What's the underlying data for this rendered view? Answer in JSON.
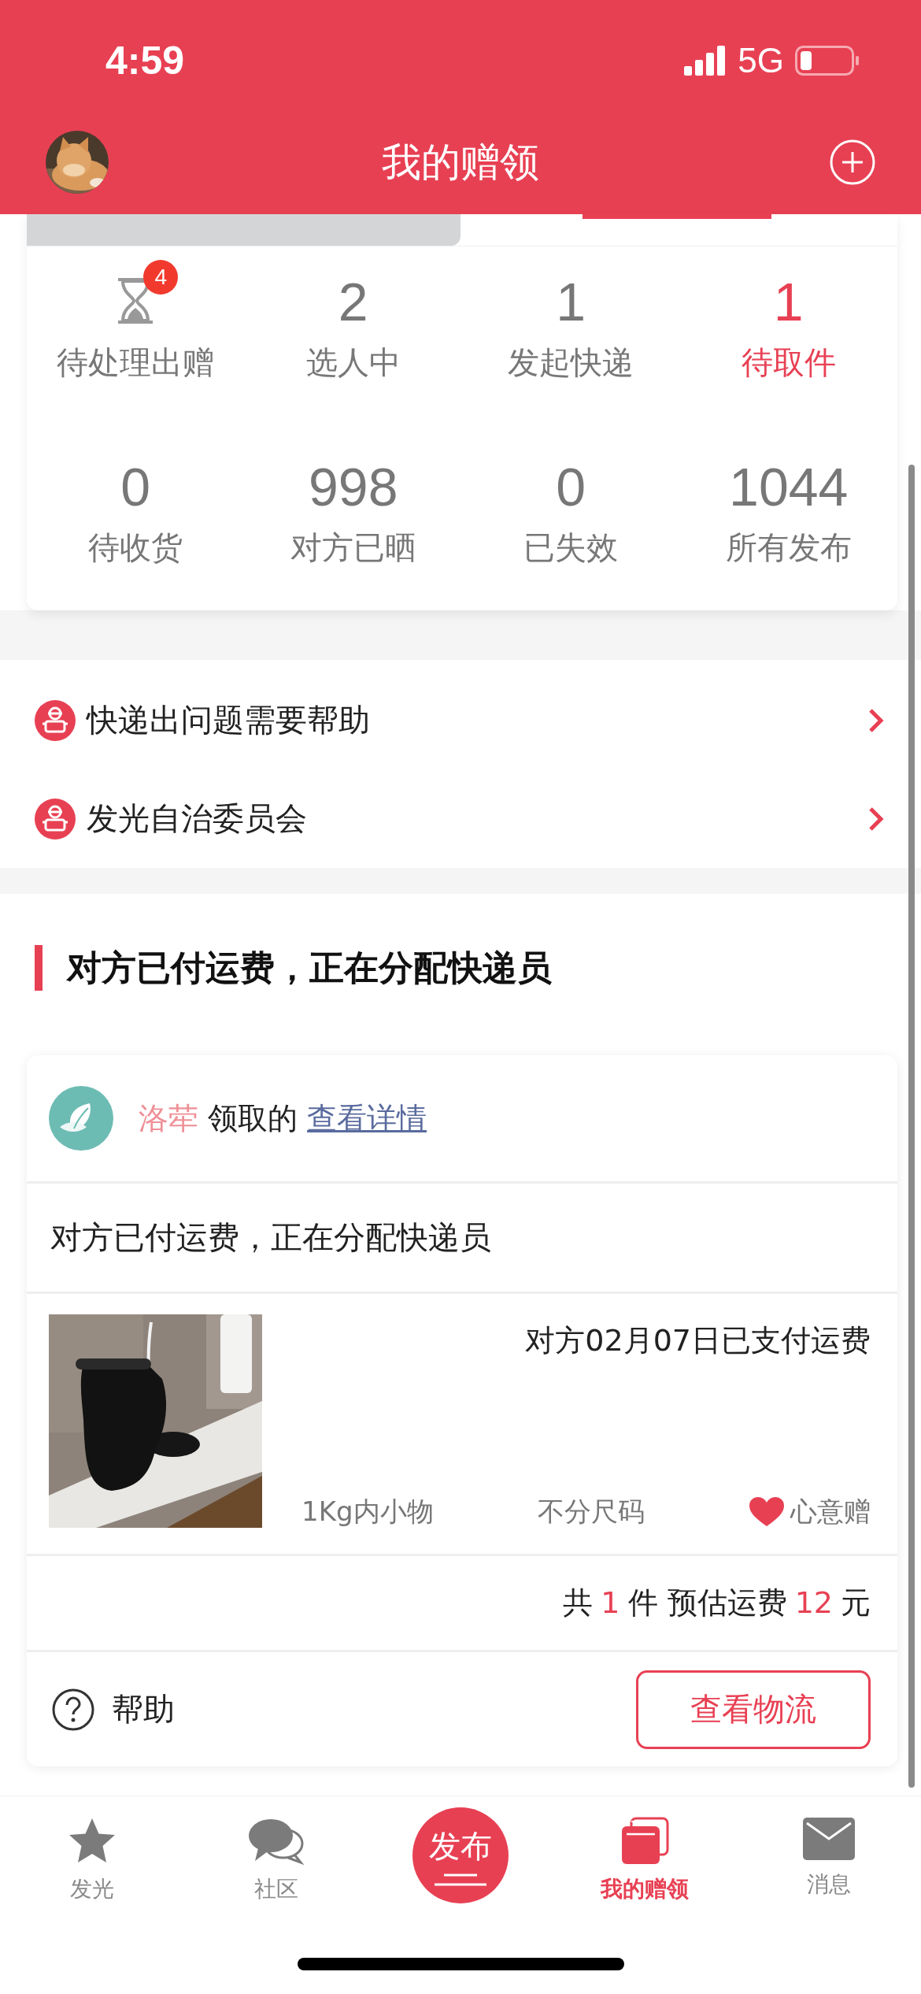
{
  "status_bar": {
    "time": "4:59",
    "network": "5G"
  },
  "header": {
    "title": "我的赠领"
  },
  "stats": [
    {
      "kind": "icon",
      "badge": "4",
      "label": "待处理出赠",
      "selected": false
    },
    {
      "kind": "count",
      "value": "2",
      "label": "选人中",
      "selected": false
    },
    {
      "kind": "count",
      "value": "1",
      "label": "发起快递",
      "selected": false
    },
    {
      "kind": "count",
      "value": "1",
      "label": "待取件",
      "selected": true
    },
    {
      "kind": "count",
      "value": "0",
      "label": "待收货",
      "selected": false
    },
    {
      "kind": "count",
      "value": "998",
      "label": "对方已晒",
      "selected": false
    },
    {
      "kind": "count",
      "value": "0",
      "label": "已失效",
      "selected": false
    },
    {
      "kind": "count",
      "value": "1044",
      "label": "所有发布",
      "selected": false
    }
  ],
  "menu": [
    {
      "label": "快递出问题需要帮助"
    },
    {
      "label": "发光自治委员会"
    }
  ],
  "section_title": "对方已付运费，正在分配快递员",
  "order": {
    "receiver": "洛荦",
    "action": "领取的",
    "details_link": "查看详情",
    "status": "对方已付运费，正在分配快递员",
    "paid_note": "对方02月07日已支付运费",
    "tags": [
      "1Kg内小物",
      "不分尺码"
    ],
    "gift_type": "心意赠",
    "summary": [
      {
        "text": "共",
        "highlight": false
      },
      {
        "text": "1",
        "highlight": true
      },
      {
        "text": "件 预估运费",
        "highlight": false
      },
      {
        "text": "12",
        "highlight": true
      },
      {
        "text": "元",
        "highlight": false
      }
    ],
    "help": "帮助",
    "track_button": "查看物流"
  },
  "tab_bar": [
    {
      "kind": "tab",
      "label": "发光",
      "selected": false
    },
    {
      "kind": "tab",
      "label": "社区",
      "selected": false
    },
    {
      "kind": "publish",
      "label": "发布",
      "selected": false
    },
    {
      "kind": "tab",
      "label": "我的赠领",
      "selected": true
    },
    {
      "kind": "tab",
      "label": "消息",
      "selected": false
    }
  ]
}
